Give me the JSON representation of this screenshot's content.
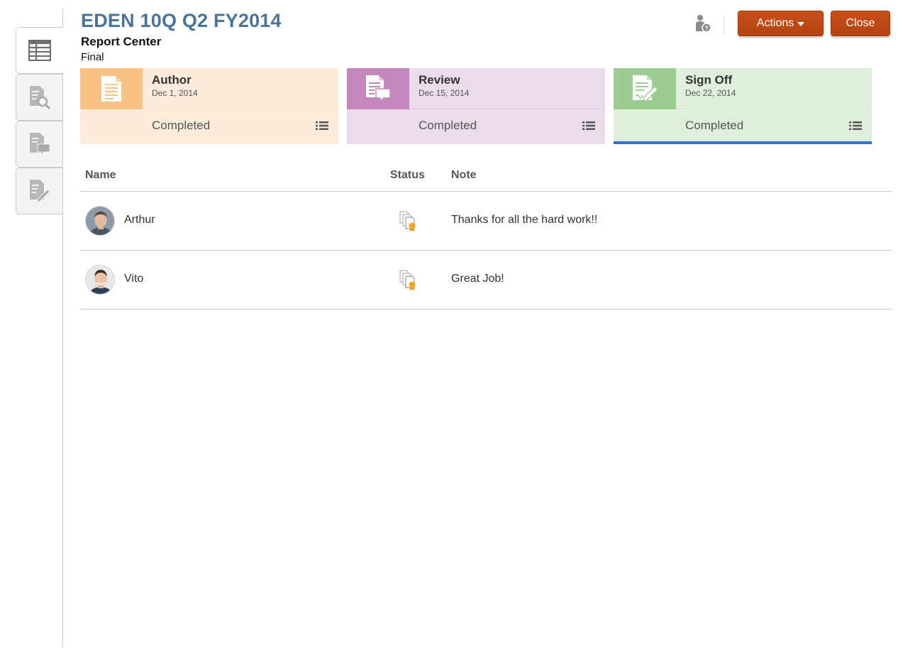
{
  "header": {
    "title": "EDEN 10Q Q2 FY2014",
    "subtitle": "Report Center",
    "status": "Final",
    "actions_label": "Actions",
    "close_label": "Close"
  },
  "side_tabs": [
    {
      "icon": "grid-table-icon",
      "active": true
    },
    {
      "icon": "document-search-icon",
      "active": false
    },
    {
      "icon": "document-comment-icon",
      "active": false
    },
    {
      "icon": "document-sign-icon",
      "active": false
    }
  ],
  "phases": [
    {
      "name": "Author",
      "date": "Dec 1, 2014",
      "status": "Completed",
      "color": "#f8c282",
      "icon": "document-icon"
    },
    {
      "name": "Review",
      "date": "Dec 15, 2014",
      "status": "Completed",
      "color": "#c586bd",
      "icon": "document-comment-icon"
    },
    {
      "name": "Sign Off",
      "date": "Dec 22, 2014",
      "status": "Completed",
      "color": "#9bcd90",
      "icon": "document-sign-icon",
      "selected": true
    }
  ],
  "table": {
    "columns": [
      "Name",
      "Status",
      "Note"
    ],
    "rows": [
      {
        "name": "Arthur",
        "status_icon": "approved-certificate-icon",
        "note": "Thanks for all the hard work!!"
      },
      {
        "name": "Vito",
        "status_icon": "approved-certificate-icon",
        "note": "Great Job!"
      }
    ]
  },
  "colors": {
    "title": "#4a7396",
    "button": "#b24310",
    "selected_underline": "#2e72d2"
  }
}
